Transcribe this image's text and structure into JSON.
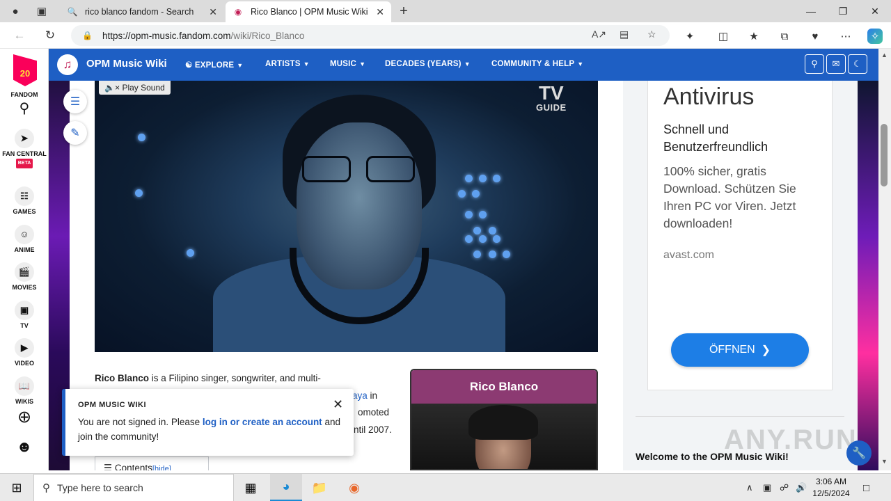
{
  "browser": {
    "tabs": [
      {
        "title": "rico blanco fandom - Search",
        "icon": "search-icon"
      },
      {
        "title": "Rico Blanco | OPM Music Wiki | F",
        "icon": "fandom-favicon",
        "active": true
      }
    ],
    "url_host": "https://opm-music.fandom.com",
    "url_path": "/wiki/Rico_Blanco"
  },
  "rail": {
    "logo_text": "20",
    "fandom_label": "FANDOM",
    "items": [
      {
        "label": "FAN CENTRAL",
        "badge": "BETA"
      },
      {
        "label": "GAMES"
      },
      {
        "label": "ANIME"
      },
      {
        "label": "MOVIES"
      },
      {
        "label": "TV"
      },
      {
        "label": "VIDEO"
      },
      {
        "label": "WIKIS"
      }
    ]
  },
  "wiki": {
    "name": "OPM Music Wiki",
    "nav": [
      "EXPLORE",
      "ARTISTS",
      "MUSIC",
      "DECADES (YEARS)",
      "COMMUNITY & HELP"
    ]
  },
  "video": {
    "play_sound": "Play Sound",
    "tv_guide_line1": "TV",
    "tv_guide_line2": "GUIDE"
  },
  "article": {
    "subject": "Rico Blanco",
    "line1_rest": " is a Filipino singer, songwriter, and multi-",
    "line2_link": "aya",
    "line2_rest": " in",
    "line3": "omoted",
    "line4": "ntil 2007."
  },
  "infobox": {
    "title": "Rico Blanco"
  },
  "toc": {
    "label": "Contents",
    "hide": "[hide]"
  },
  "popup": {
    "header": "OPM MUSIC WIKI",
    "text_before": "You are not signed in. Please ",
    "link": "log in or create an account",
    "text_after": " and join the community!"
  },
  "ad": {
    "title": "Antivirus",
    "subtitle": "Schnell und Benutzerfreundlich",
    "description": "100% sicher, gratis Download. Schützen Sie Ihren PC vor Viren. Jetzt downloaden!",
    "domain": "avast.com",
    "button": "ÖFFNEN"
  },
  "sidebar": {
    "welcome": "Welcome to the OPM Music Wiki!"
  },
  "watermark": "ANY.RUN",
  "taskbar": {
    "search_placeholder": "Type here to search",
    "time": "3:06 AM",
    "date": "12/5/2024"
  }
}
